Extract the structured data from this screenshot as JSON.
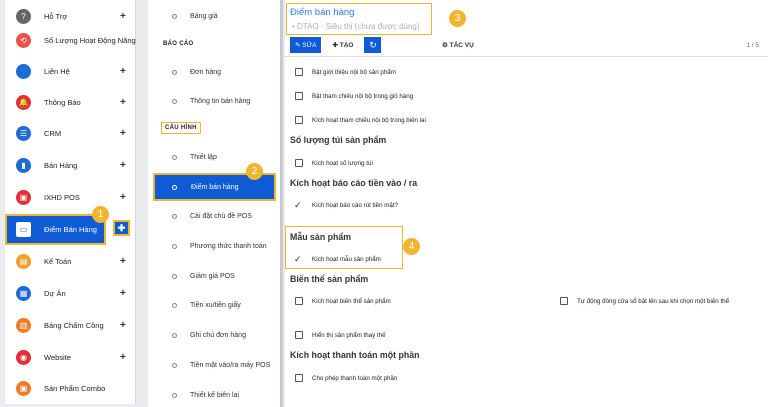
{
  "app_menu": {
    "items": [
      {
        "label": "Hỗ Trợ",
        "icon": "help-icon",
        "color": "#666666",
        "has_plus": true
      },
      {
        "label": "Số Lượng Hoạt Động Năng",
        "icon": "history-icon",
        "color": "#e8534a",
        "has_plus": false
      },
      {
        "label": "Liên Hệ",
        "icon": "contacts-icon",
        "color": "#1e6ad6",
        "has_plus": true
      },
      {
        "label": "Thông Báo",
        "icon": "bell-icon",
        "color": "#e0303a",
        "has_plus": true
      },
      {
        "label": "CRM",
        "icon": "crm-icon",
        "color": "#1e6ad6",
        "has_plus": true
      },
      {
        "label": "Bán Hàng",
        "icon": "sales-chart-icon",
        "color": "#1e6ad6",
        "has_plus": true
      },
      {
        "label": "IXHD POS",
        "icon": "pos-icon",
        "color": "#e0303a",
        "has_plus": true
      },
      {
        "label": "Điểm Bán Hàng",
        "icon": "store-icon",
        "color": "#0f5bd6",
        "has_plus": true,
        "active": true
      },
      {
        "label": "Kế Toán",
        "icon": "accounting-icon",
        "color": "#f0a12b",
        "has_plus": true
      },
      {
        "label": "Dự Án",
        "icon": "project-icon",
        "color": "#1e6ad6",
        "has_plus": true
      },
      {
        "label": "Bảng Chấm Công",
        "icon": "timesheet-icon",
        "color": "#f07b2b",
        "has_plus": true
      },
      {
        "label": "Website",
        "icon": "website-icon",
        "color": "#e0303a",
        "has_plus": true
      },
      {
        "label": "Sản Phẩm Combo",
        "icon": "combo-icon",
        "color": "#f07b2b",
        "has_plus": false
      }
    ]
  },
  "sub_menu": {
    "top_item": "Bảng giá",
    "bao_cao_heading": "BÁO CÁO",
    "bao_cao_items": [
      "Đơn hàng",
      "Thông tin bán hàng"
    ],
    "cau_hinh_heading": "CẤU HÌNH",
    "cau_hinh_items": [
      {
        "label": "Thiết lập"
      },
      {
        "label": "Điểm bán hàng",
        "active": true
      },
      {
        "label": "Cài đặt chủ đề POS"
      },
      {
        "label": "Phương thức thanh toán"
      },
      {
        "label": "Giảm giá POS"
      },
      {
        "label": "Tiền xu/tiền giấy"
      },
      {
        "label": "Ghi chú đơn hàng"
      },
      {
        "label": "Tiền mặt vào/ra máy POS"
      },
      {
        "label": "Thiết kế biên lai"
      }
    ]
  },
  "main": {
    "title": "Điểm bán hàng",
    "record": "• DTAO · Siêu thị (chưa được dùng)",
    "toolbar": {
      "edit": "✎ SỬA",
      "create": "✚ TẠO",
      "refresh_icon": "↻",
      "actions": "⚙ TÁC VỤ"
    },
    "pager": "1 / 5",
    "checkboxes_top": [
      "Bật giới thiệu nội bộ sản phẩm",
      "Bật tham chiếu nội bộ trong giỏ hàng",
      "Kích hoạt tham chiếu nội bộ trong biên lai"
    ],
    "section_tui": "Số lượng túi sản phẩm",
    "cb_tui": "Kích hoạt số lượng túi",
    "section_tien": "Kích hoạt báo cáo tiền vào / ra",
    "cb_tien": "Kích hoạt báo cáo rút tiền mặt?",
    "section_mau": "Mẫu sản phẩm",
    "cb_mau": "Kích hoạt mẫu sản phẩm",
    "section_bien_the": "Biến thể sản phẩm",
    "cb_bien_the": "Kích hoạt biến thể sản phẩm",
    "cb_tu_dong": "Tự động đóng cửa sổ bật lên sau khi chọn một biến thể",
    "cb_hien_thi": "Hiển thị sản phẩm thay thế",
    "section_thanh_toan": "Kích hoạt thanh toán một phần",
    "cb_thanh_toan": "Cho phép thanh toán một phần"
  },
  "callouts": [
    "1",
    "2",
    "3",
    "4"
  ]
}
